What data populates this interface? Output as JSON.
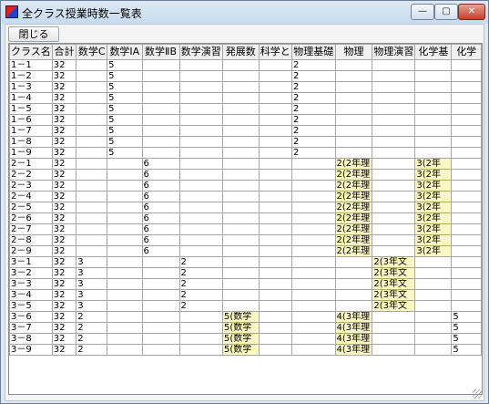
{
  "window": {
    "title": "全クラス授業時数一覧表",
    "controls": {
      "minimize": "—",
      "maximize": "▢",
      "close": "✕"
    }
  },
  "toolbar": {
    "close_label": "閉じる"
  },
  "table": {
    "columns": [
      "クラス名",
      "合計",
      "数学C",
      "数学ⅠA",
      "数学ⅡB",
      "数学演習",
      "発展数",
      "科学と",
      "物理基礎",
      "物理",
      "物理演習",
      "化学基",
      "化学"
    ],
    "rows": [
      [
        "1－1",
        "32",
        "",
        "5",
        "",
        "",
        "",
        "",
        "2",
        "",
        "",
        "",
        ""
      ],
      [
        "1－2",
        "32",
        "",
        "5",
        "",
        "",
        "",
        "",
        "2",
        "",
        "",
        "",
        ""
      ],
      [
        "1－3",
        "32",
        "",
        "5",
        "",
        "",
        "",
        "",
        "2",
        "",
        "",
        "",
        ""
      ],
      [
        "1－4",
        "32",
        "",
        "5",
        "",
        "",
        "",
        "",
        "2",
        "",
        "",
        "",
        ""
      ],
      [
        "1－5",
        "32",
        "",
        "5",
        "",
        "",
        "",
        "",
        "2",
        "",
        "",
        "",
        ""
      ],
      [
        "1－6",
        "32",
        "",
        "5",
        "",
        "",
        "",
        "",
        "2",
        "",
        "",
        "",
        ""
      ],
      [
        "1－7",
        "32",
        "",
        "5",
        "",
        "",
        "",
        "",
        "2",
        "",
        "",
        "",
        ""
      ],
      [
        "1－8",
        "32",
        "",
        "5",
        "",
        "",
        "",
        "",
        "2",
        "",
        "",
        "",
        ""
      ],
      [
        "1－9",
        "32",
        "",
        "5",
        "",
        "",
        "",
        "",
        "2",
        "",
        "",
        "",
        ""
      ],
      [
        "2－1",
        "32",
        "",
        "",
        "6",
        "",
        "",
        "",
        "",
        "2(2年理",
        "",
        "3(2年",
        ""
      ],
      [
        "2－2",
        "32",
        "",
        "",
        "6",
        "",
        "",
        "",
        "",
        "2(2年理",
        "",
        "3(2年",
        ""
      ],
      [
        "2－3",
        "32",
        "",
        "",
        "6",
        "",
        "",
        "",
        "",
        "2(2年理",
        "",
        "3(2年",
        ""
      ],
      [
        "2－4",
        "32",
        "",
        "",
        "6",
        "",
        "",
        "",
        "",
        "2(2年理",
        "",
        "3(2年",
        ""
      ],
      [
        "2－5",
        "32",
        "",
        "",
        "6",
        "",
        "",
        "",
        "",
        "2(2年理",
        "",
        "3(2年",
        ""
      ],
      [
        "2－6",
        "32",
        "",
        "",
        "6",
        "",
        "",
        "",
        "",
        "2(2年理",
        "",
        "3(2年",
        ""
      ],
      [
        "2－7",
        "32",
        "",
        "",
        "6",
        "",
        "",
        "",
        "",
        "2(2年理",
        "",
        "3(2年",
        ""
      ],
      [
        "2－8",
        "32",
        "",
        "",
        "6",
        "",
        "",
        "",
        "",
        "2(2年理",
        "",
        "3(2年",
        ""
      ],
      [
        "2－9",
        "32",
        "",
        "",
        "6",
        "",
        "",
        "",
        "",
        "2(2年理",
        "",
        "3(2年",
        ""
      ],
      [
        "3－1",
        "32",
        "3",
        "",
        "",
        "2",
        "",
        "",
        "",
        "",
        "2(3年文",
        "",
        ""
      ],
      [
        "3－2",
        "32",
        "3",
        "",
        "",
        "2",
        "",
        "",
        "",
        "",
        "2(3年文",
        "",
        ""
      ],
      [
        "3－3",
        "32",
        "3",
        "",
        "",
        "2",
        "",
        "",
        "",
        "",
        "2(3年文",
        "",
        ""
      ],
      [
        "3－4",
        "32",
        "3",
        "",
        "",
        "2",
        "",
        "",
        "",
        "",
        "2(3年文",
        "",
        ""
      ],
      [
        "3－5",
        "32",
        "3",
        "",
        "",
        "2",
        "",
        "",
        "",
        "",
        "2(3年文",
        "",
        ""
      ],
      [
        "3－6",
        "32",
        "2",
        "",
        "",
        "",
        "5(数学",
        "",
        "",
        "4(3年理",
        "",
        "",
        "5"
      ],
      [
        "3－7",
        "32",
        "2",
        "",
        "",
        "",
        "5(数学",
        "",
        "",
        "4(3年理",
        "",
        "",
        "5"
      ],
      [
        "3－8",
        "32",
        "2",
        "",
        "",
        "",
        "5(数学",
        "",
        "",
        "4(3年理",
        "",
        "",
        "5"
      ],
      [
        "3－9",
        "32",
        "2",
        "",
        "",
        "",
        "5(数学",
        "",
        "",
        "4(3年理",
        "",
        "",
        "5"
      ]
    ],
    "highlight_color": "#fdf8c3"
  }
}
